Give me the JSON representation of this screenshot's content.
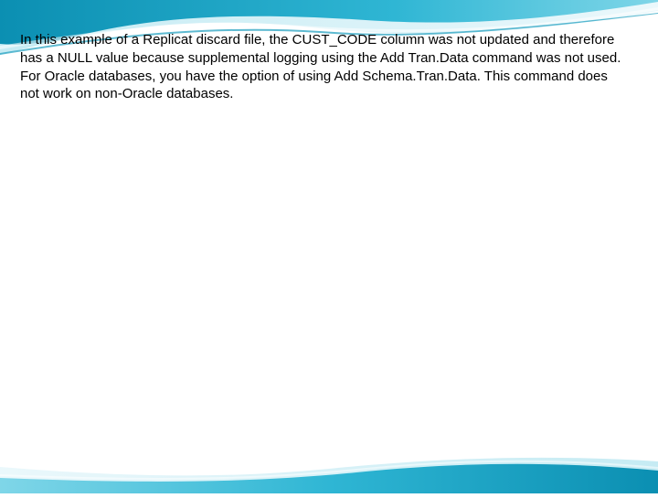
{
  "body": {
    "paragraph1": "In this example of a Replicat discard file, the CUST_CODE column was not updated and therefore has a NULL value because supplemental logging using the Add Tran.Data command was not used.",
    "paragraph2": "For Oracle databases, you have the option of using Add Schema.Tran.Data. This command does not work on non-Oracle databases."
  },
  "theme": {
    "wave_dark": "#0b8fb2",
    "wave_light": "#7fd6e8",
    "wave_highlight": "#cdeef5"
  }
}
